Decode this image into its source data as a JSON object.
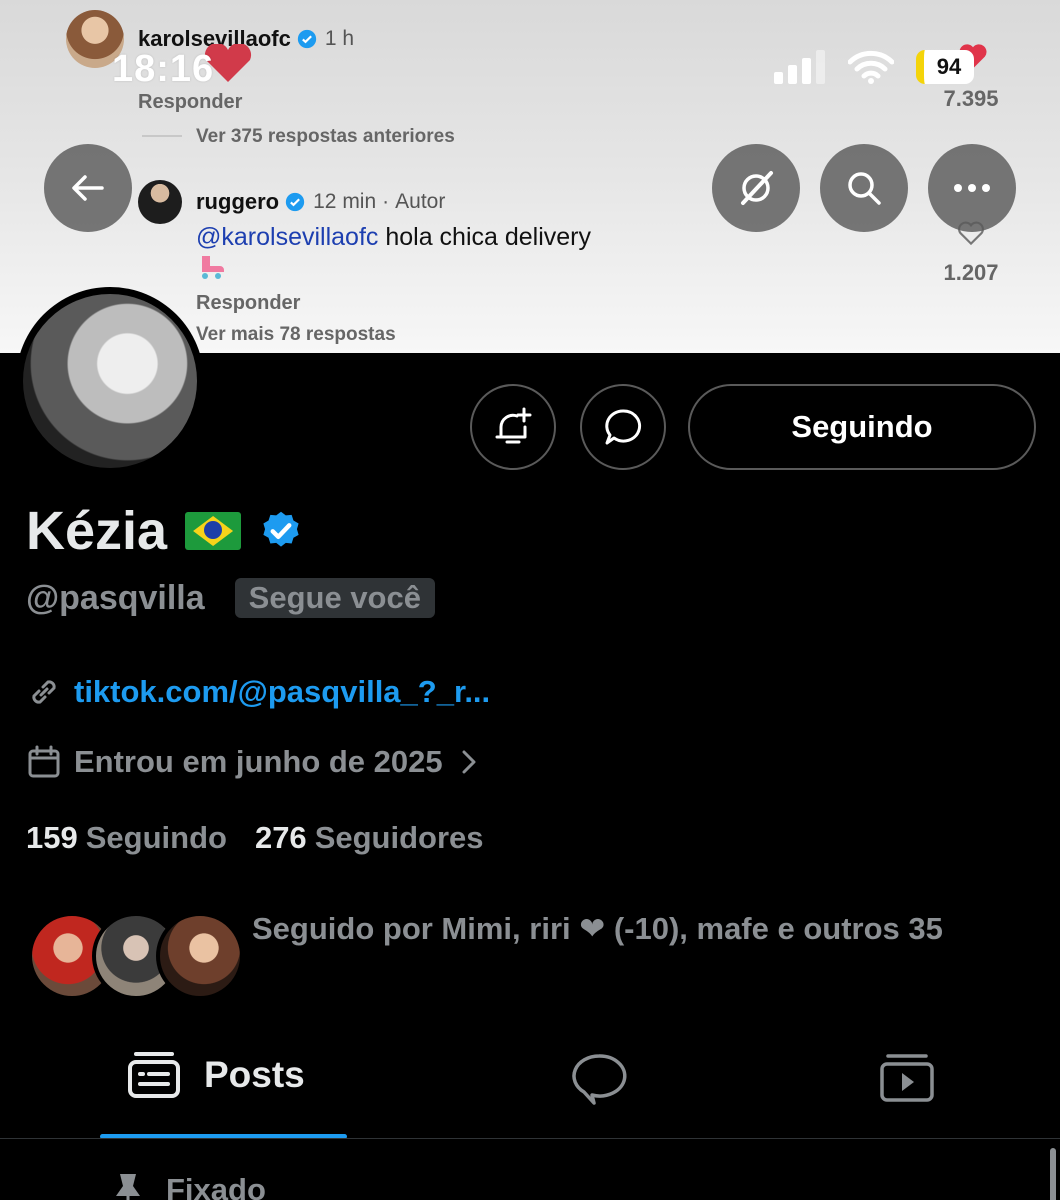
{
  "status_bar": {
    "time": "18:16",
    "battery": "94"
  },
  "background_comments": {
    "top_comment": {
      "username": "karolsevillaofc",
      "time": "1 h",
      "reply": "Responder",
      "likes": "7.395"
    },
    "view_previous": "Ver 375 respostas anteriores",
    "reply_comment": {
      "username": "ruggero",
      "time": "12 min",
      "author_tag": "Autor",
      "mention": "@karolsevillaofc",
      "text": "hola chica delivery",
      "reply": "Responder",
      "likes": "1.207",
      "view_more": "Ver mais 78 respostas"
    }
  },
  "profile": {
    "name": "Kézia",
    "handle": "@pasqvilla",
    "follows_you": "Segue você",
    "link": "tiktok.com/@pasqvilla_?_r...",
    "joined": "Entrou em junho de 2025",
    "following_count": "159",
    "following_label": "Seguindo",
    "followers_count": "276",
    "followers_label": "Seguidores",
    "followed_by": "Seguido por Mimi, riri ❤ (-10), mafe e outros 35",
    "follow_button": "Seguindo"
  },
  "tabs": {
    "posts": "Posts"
  },
  "pinned": {
    "label": "Fixado"
  },
  "colors": {
    "accent": "#1d9bf0",
    "background": "#000000",
    "secondary_text": "#8b8f93",
    "primary_text": "#e7e9ea"
  },
  "icons": {
    "back": "arrow-left-icon",
    "grok": "grok-icon",
    "search": "search-icon",
    "more": "more-horizontal-icon",
    "notify": "bell-plus-icon",
    "message": "chat-bubble-icon",
    "link": "link-icon",
    "calendar": "calendar-icon",
    "posts_tab": "posts-tab-icon",
    "replies_tab": "chat-bubble-icon",
    "media_tab": "video-icon",
    "pin": "pin-icon"
  }
}
